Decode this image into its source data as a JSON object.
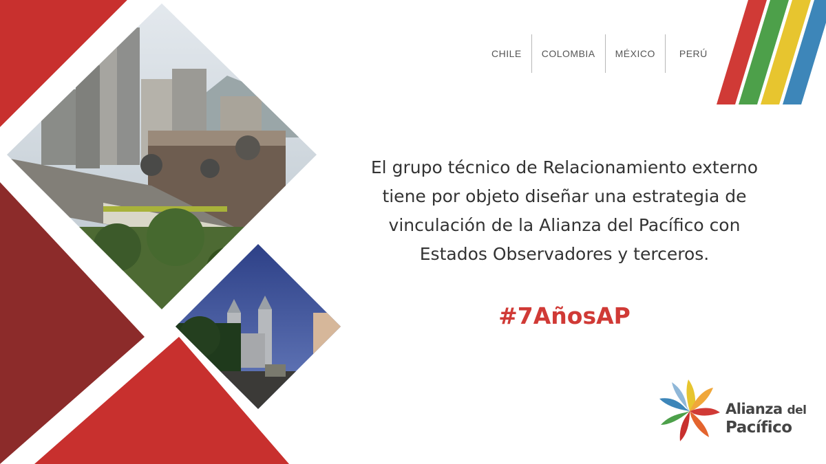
{
  "countries": [
    "CHILE",
    "COLOMBIA",
    "MÉXICO",
    "PERÚ"
  ],
  "message": "El grupo técnico de Relacionamiento externo tiene por objeto diseñar una estrategia de vinculación de la Alianza del Pacífico con Estados Observadores y terceros.",
  "hashtag": "#7AñosAP",
  "logo": {
    "line1_a": "Alianza",
    "line1_b": "del",
    "line2": "Pacífico"
  },
  "colors": {
    "red": "#d03a36",
    "dark_red": "#8c2b2a",
    "green": "#4da04a",
    "yellow": "#e7c52f",
    "blue": "#3d86b9",
    "text": "#333333"
  },
  "icons": [
    "alianza-pinwheel-icon",
    "stripes-decoration-icon"
  ]
}
